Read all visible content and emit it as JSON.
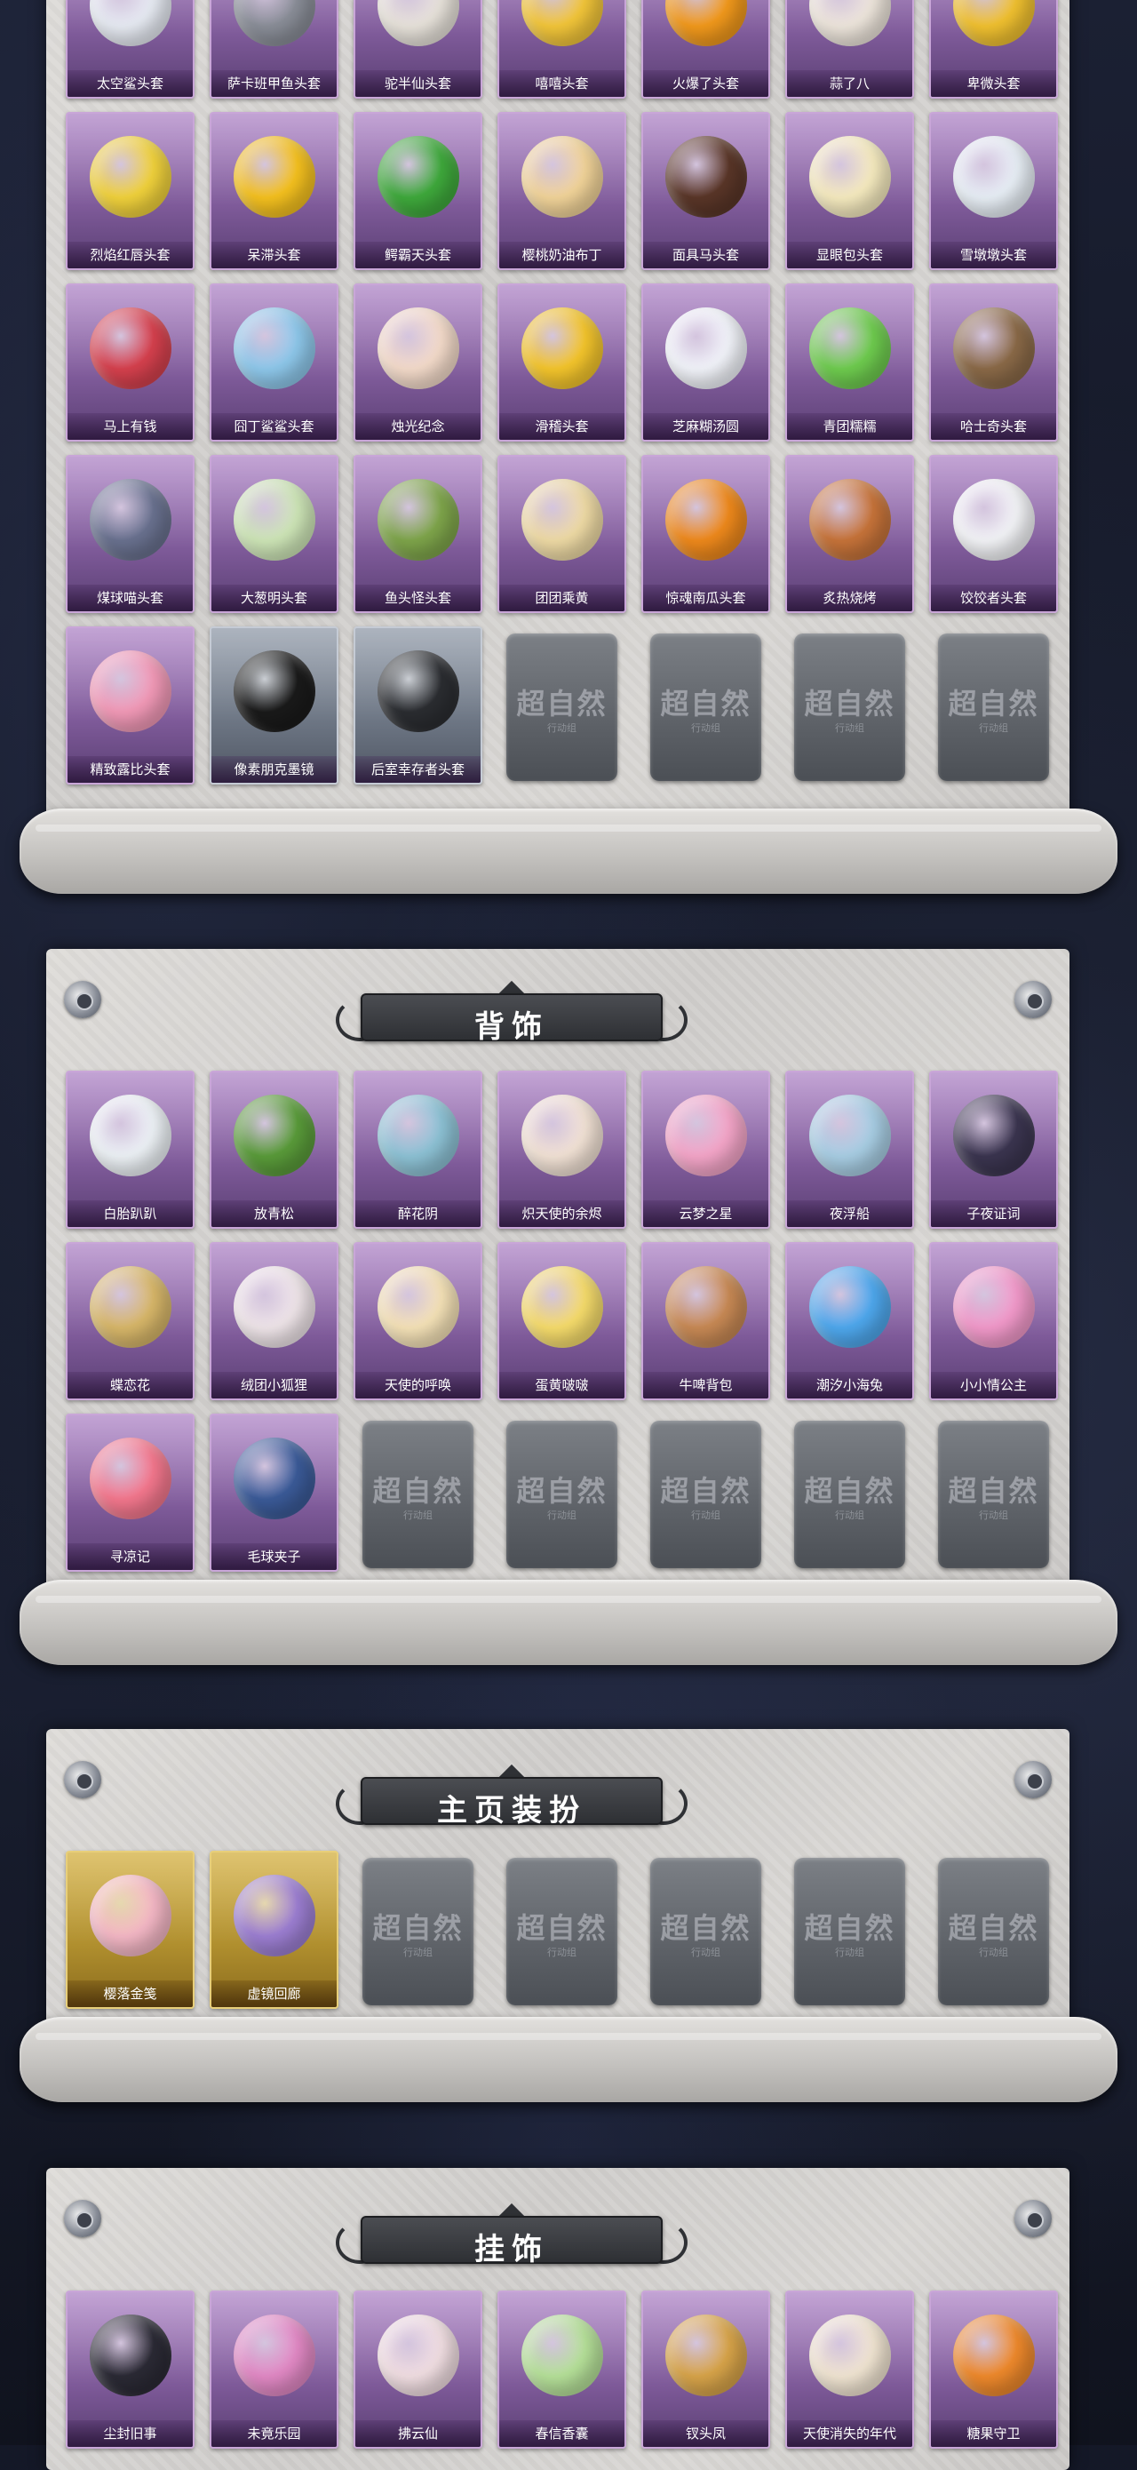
{
  "empty_slot": {
    "logo_text": "超自然",
    "logo_sub": "行动组"
  },
  "sections": [
    {
      "id": "headwear",
      "title": "",
      "items": [
        {
          "label": "太空鲨头套",
          "color": "#e8ecf4"
        },
        {
          "label": "萨卡班甲鱼头套",
          "color": "#8b8f99"
        },
        {
          "label": "驼半仙头套",
          "color": "#e9e4dc"
        },
        {
          "label": "嘻嘻头套",
          "color": "#f4c73a"
        },
        {
          "label": "火爆了头套",
          "color": "#f39a1c"
        },
        {
          "label": "蒜了八",
          "color": "#efe7dd"
        },
        {
          "label": "卑微头套",
          "color": "#f2c230"
        },
        {
          "label": "烈焰红唇头套",
          "color": "#f2d33c"
        },
        {
          "label": "呆滞头套",
          "color": "#f6c21f"
        },
        {
          "label": "鳄霸天头套",
          "color": "#3faa3c"
        },
        {
          "label": "樱桃奶油布丁",
          "color": "#f3d59a"
        },
        {
          "label": "面具马头套",
          "color": "#5a3628"
        },
        {
          "label": "显眼包头套",
          "color": "#f7ecc0"
        },
        {
          "label": "雪墩墩头套",
          "color": "#e9f0f7"
        },
        {
          "label": "马上有钱",
          "color": "#d7414e"
        },
        {
          "label": "囧丁鲨鲨头套",
          "color": "#8fc9ec"
        },
        {
          "label": "烛光纪念",
          "color": "#f5dccb"
        },
        {
          "label": "滑稽头套",
          "color": "#f5c62c"
        },
        {
          "label": "芝麻糊汤圆",
          "color": "#f3f5fb"
        },
        {
          "label": "青团糯糯",
          "color": "#6fcd4f"
        },
        {
          "label": "哈士奇头套",
          "color": "#8b6a48"
        },
        {
          "label": "煤球喵头套",
          "color": "#6a7290"
        },
        {
          "label": "大葱明头套",
          "color": "#cfe7b8"
        },
        {
          "label": "鱼头怪头套",
          "color": "#7fa64b"
        },
        {
          "label": "团团乘黄",
          "color": "#f0dca6"
        },
        {
          "label": "惊魂南瓜头套",
          "color": "#f08a1c"
        },
        {
          "label": "炙热烧烤",
          "color": "#c8743a"
        },
        {
          "label": "饺饺者头套",
          "color": "#f4f5f8"
        },
        {
          "label": "精致露比头套",
          "color": "#f39ab8"
        },
        {
          "label": "像素朋克墨镜",
          "color": "#1a1a1a",
          "style": "silver"
        },
        {
          "label": "后室幸存者头套",
          "color": "#2b2d31",
          "style": "silver"
        }
      ],
      "empty_count": 4
    },
    {
      "id": "back-accessory",
      "title": "背饰",
      "items": [
        {
          "label": "白胎趴趴",
          "color": "#eef3f7"
        },
        {
          "label": "放青松",
          "color": "#5a9c3a"
        },
        {
          "label": "醉花阴",
          "color": "#8ec3d6"
        },
        {
          "label": "炽天使的余烬",
          "color": "#f3e3d6"
        },
        {
          "label": "云梦之星",
          "color": "#f5a6c9"
        },
        {
          "label": "夜浮船",
          "color": "#a9cfe5"
        },
        {
          "label": "子夜证词",
          "color": "#3b3550"
        },
        {
          "label": "蝶恋花",
          "color": "#d9b86a"
        },
        {
          "label": "绒团小狐狸",
          "color": "#f0e6ea"
        },
        {
          "label": "天使的呼唤",
          "color": "#f6e3b8"
        },
        {
          "label": "蛋黄啵啵",
          "color": "#f7dd6c"
        },
        {
          "label": "牛啤背包",
          "color": "#c98a55"
        },
        {
          "label": "潮汐小海兔",
          "color": "#4fa9ef"
        },
        {
          "label": "小小情公主",
          "color": "#f39acb"
        },
        {
          "label": "寻凉记",
          "color": "#f5788e"
        },
        {
          "label": "毛球夹子",
          "color": "#3b5b99"
        }
      ],
      "empty_count": 5
    },
    {
      "id": "homepage-decor",
      "title": "主页装扮",
      "items": [
        {
          "label": "樱落金笺",
          "color": "#f5b8c6",
          "style": "gold"
        },
        {
          "label": "虚镜回廊",
          "color": "#9d7fd3",
          "style": "gold"
        }
      ],
      "empty_count": 5
    },
    {
      "id": "hanging-accessory",
      "title": "挂饰",
      "items": [
        {
          "label": "尘封旧事",
          "color": "#2b2a35"
        },
        {
          "label": "未竟乐园",
          "color": "#e38ac6"
        },
        {
          "label": "拂云仙",
          "color": "#f2dfe3"
        },
        {
          "label": "春信香囊",
          "color": "#b7e29a"
        },
        {
          "label": "钗头凤",
          "color": "#d9a54a"
        },
        {
          "label": "天使消失的年代",
          "color": "#f2e6d3"
        },
        {
          "label": "糖果守卫",
          "color": "#f08a2c"
        }
      ],
      "empty_count": 0
    }
  ]
}
